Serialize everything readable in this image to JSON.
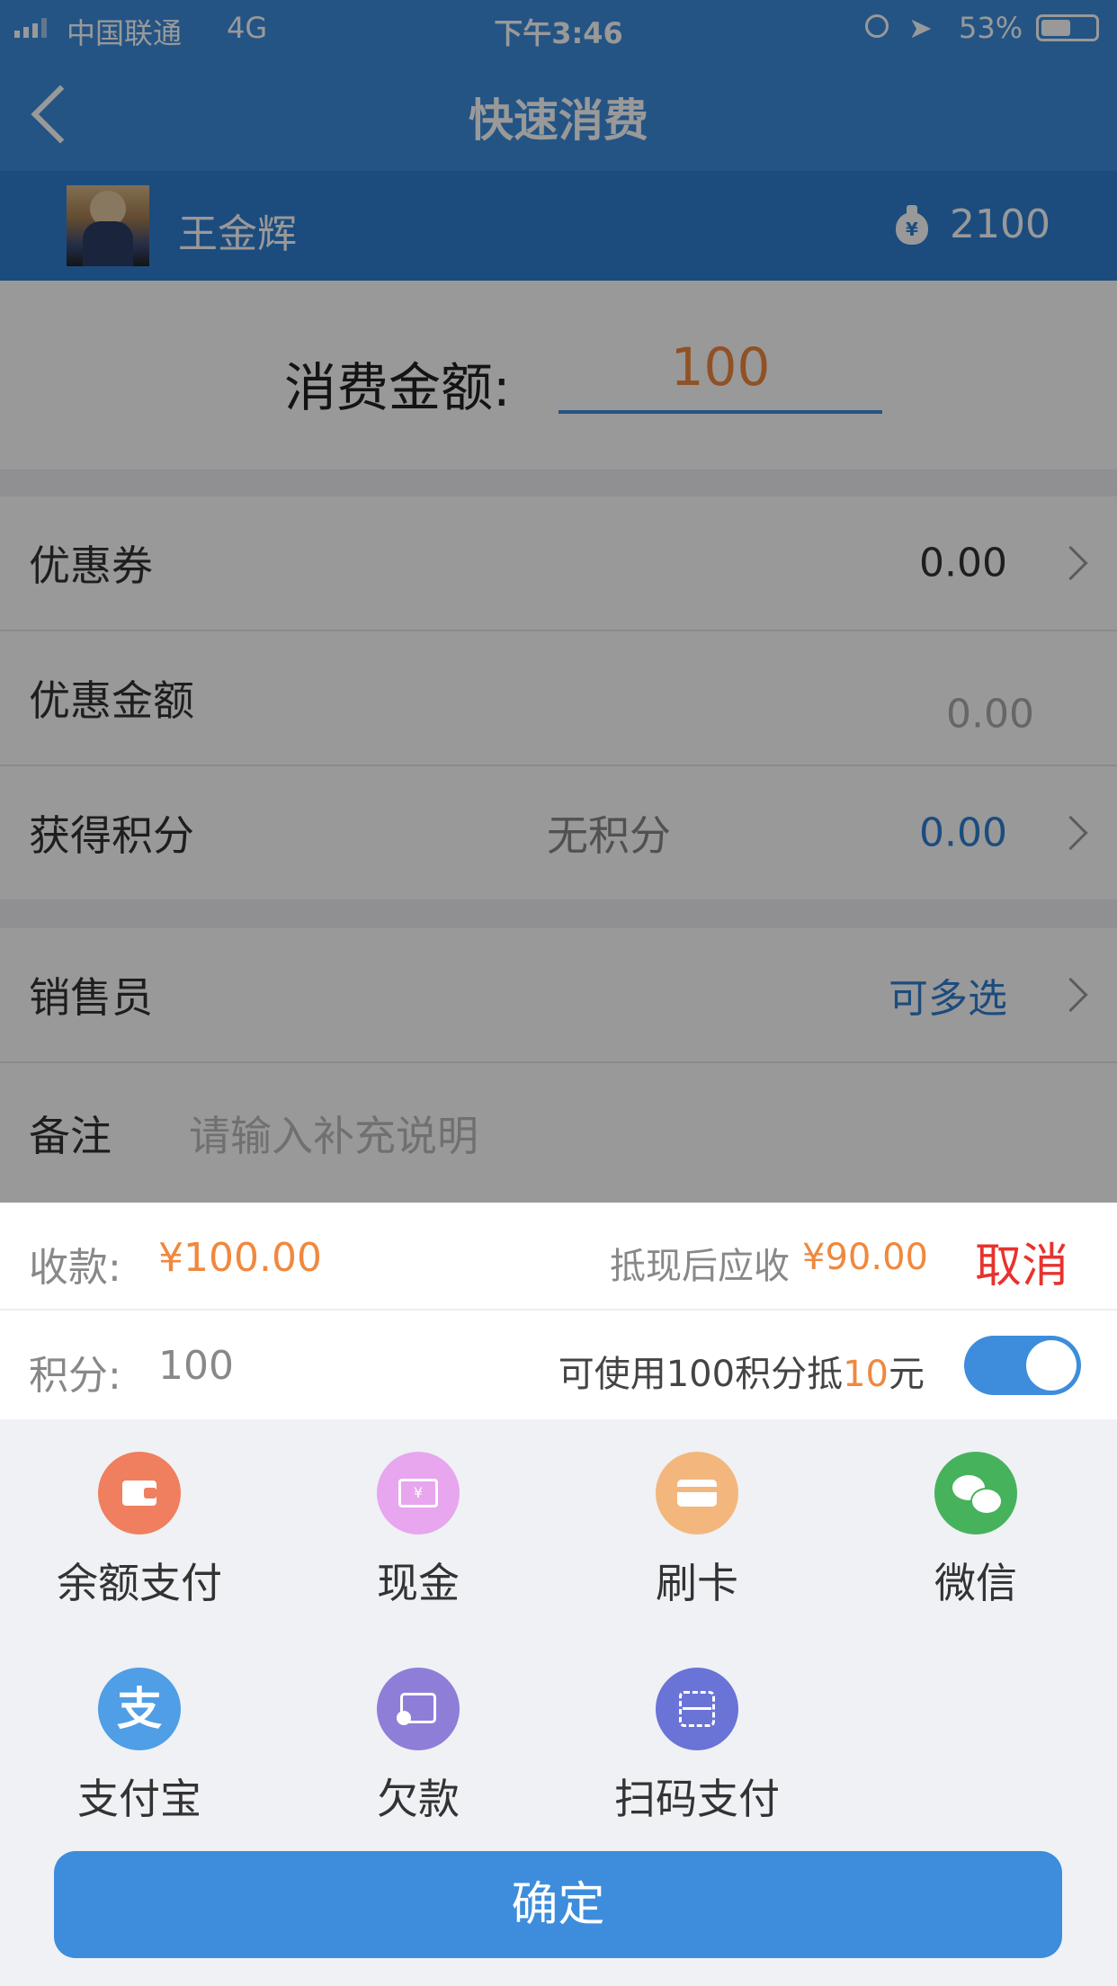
{
  "status_bar": {
    "carrier": "中国联通",
    "network": "4G",
    "time": "下午3:46",
    "battery": "53%"
  },
  "nav": {
    "title": "快速消费"
  },
  "member": {
    "name": "王金辉",
    "points": "2100"
  },
  "amount": {
    "label": "消费金额:",
    "value": "100"
  },
  "rows": {
    "coupon": {
      "label": "优惠券",
      "value": "0.00"
    },
    "discount": {
      "label": "优惠金额",
      "value": "0.00"
    },
    "earn_points": {
      "label": "获得积分",
      "hint": "无积分",
      "value": "0.00"
    },
    "salesperson": {
      "label": "销售员",
      "value": "可多选"
    },
    "remark": {
      "label": "备注",
      "placeholder": "请输入补充说明"
    }
  },
  "sheet": {
    "receive_label": "收款:",
    "receive_amount": "¥100.00",
    "after_label": "抵现后应收",
    "after_amount": "¥90.00",
    "cancel": "取消",
    "points_label": "积分:",
    "points_value": "100",
    "deduct_prefix": "可使用100积分抵",
    "deduct_amount": "10",
    "deduct_unit": "元",
    "deduct_enabled": true
  },
  "payment_methods": [
    {
      "label": "余额支付",
      "icon": "wallet-icon",
      "color": "#ef7f5e"
    },
    {
      "label": "现金",
      "icon": "cash-icon",
      "color": "#e7a6ee"
    },
    {
      "label": "刷卡",
      "icon": "card-icon",
      "color": "#f3b77e"
    },
    {
      "label": "微信",
      "icon": "wechat-icon",
      "color": "#46b25c"
    },
    {
      "label": "支付宝",
      "icon": "alipay-icon",
      "color": "#4f9ee6"
    },
    {
      "label": "欠款",
      "icon": "debt-icon",
      "color": "#8f7ed8"
    },
    {
      "label": "扫码支付",
      "icon": "scan-icon",
      "color": "#6a73d6"
    }
  ],
  "confirm_label": "确定",
  "colors": {
    "primary": "#3d8ddc",
    "accent_orange": "#f0883e",
    "cancel_red": "#e8322e"
  }
}
